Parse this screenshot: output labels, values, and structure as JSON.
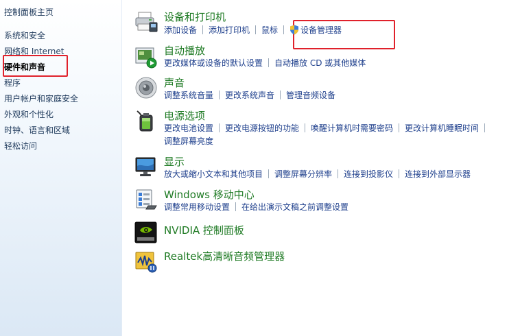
{
  "sidebar": {
    "home": "控制面板主页",
    "items": [
      {
        "label": "系统和安全"
      },
      {
        "label": "网络和 Internet"
      },
      {
        "label": "硬件和声音"
      },
      {
        "label": "程序"
      },
      {
        "label": "用户帐户和家庭安全"
      },
      {
        "label": "外观和个性化"
      },
      {
        "label": "时钟、语言和区域"
      },
      {
        "label": "轻松访问"
      }
    ]
  },
  "categories": [
    {
      "title": "设备和打印机",
      "icon": "printer-icon",
      "links": [
        "添加设备",
        "添加打印机",
        "鼠标",
        "设备管理器"
      ]
    },
    {
      "title": "自动播放",
      "icon": "autoplay-icon",
      "links": [
        "更改媒体或设备的默认设置",
        "自动播放 CD 或其他媒体"
      ]
    },
    {
      "title": "声音",
      "icon": "speaker-icon",
      "links": [
        "调整系统音量",
        "更改系统声音",
        "管理音频设备"
      ]
    },
    {
      "title": "电源选项",
      "icon": "battery-icon",
      "links": [
        "更改电池设置",
        "更改电源按钮的功能",
        "唤醒计算机时需要密码",
        "更改计算机睡眠时间",
        "调整屏幕亮度"
      ]
    },
    {
      "title": "显示",
      "icon": "monitor-icon",
      "links": [
        "放大或缩小文本和其他项目",
        "调整屏幕分辨率",
        "连接到投影仪",
        "连接到外部显示器"
      ]
    },
    {
      "title": "Windows 移动中心",
      "icon": "mobility-center-icon",
      "links": [
        "调整常用移动设置",
        "在给出演示文稿之前调整设置"
      ]
    },
    {
      "title": "NVIDIA 控制面板",
      "icon": "nvidia-icon",
      "links": []
    },
    {
      "title": "Realtek高清晰音频管理器",
      "icon": "realtek-icon",
      "links": []
    }
  ],
  "colors": {
    "title_green": "#1e7a23",
    "link_blue": "#1e3f8c",
    "highlight_red": "#e0212b"
  }
}
